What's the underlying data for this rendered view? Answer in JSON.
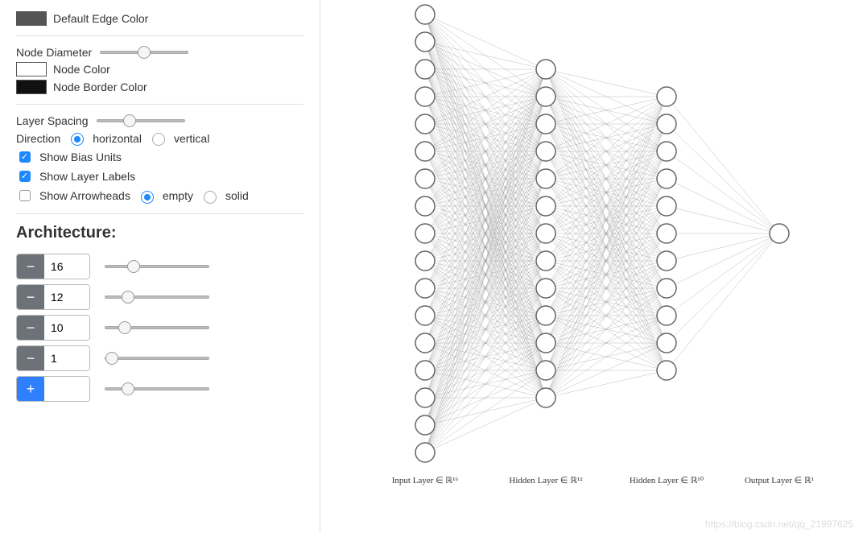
{
  "edge_color_label": "Default Edge Color",
  "node_diameter_label": "Node Diameter",
  "node_color_label": "Node Color",
  "node_border_label": "Node Border Color",
  "layer_spacing_label": "Layer Spacing",
  "direction_label": "Direction",
  "direction_options": {
    "horizontal": "horizontal",
    "vertical": "vertical"
  },
  "direction_value": "horizontal",
  "show_bias_label": "Show Bias Units",
  "show_bias_checked": true,
  "show_layer_labels_label": "Show Layer Labels",
  "show_layer_labels_checked": true,
  "show_arrowheads_label": "Show Arrowheads",
  "show_arrowheads_checked": false,
  "arrowhead_options": {
    "empty": "empty",
    "solid": "solid"
  },
  "arrowhead_value": "empty",
  "architecture": {
    "title": "Architecture:",
    "layers": [
      {
        "nodes": "16"
      },
      {
        "nodes": "12"
      },
      {
        "nodes": "10"
      },
      {
        "nodes": "1"
      }
    ]
  },
  "canvas_labels": {
    "input": "Input Layer ∈ ℝ¹⁶",
    "hidden1": "Hidden Layer ∈ ℝ¹²",
    "hidden2": "Hidden Layer ∈ ℝ¹⁰",
    "output": "Output Layer ∈ ℝ¹"
  },
  "colors": {
    "edge_default": "#555555",
    "node_fill": "#ffffff",
    "node_border": "#111111",
    "accent": "#2f80ff"
  },
  "watermark": "https://blog.csdn.net/qq_21997625"
}
